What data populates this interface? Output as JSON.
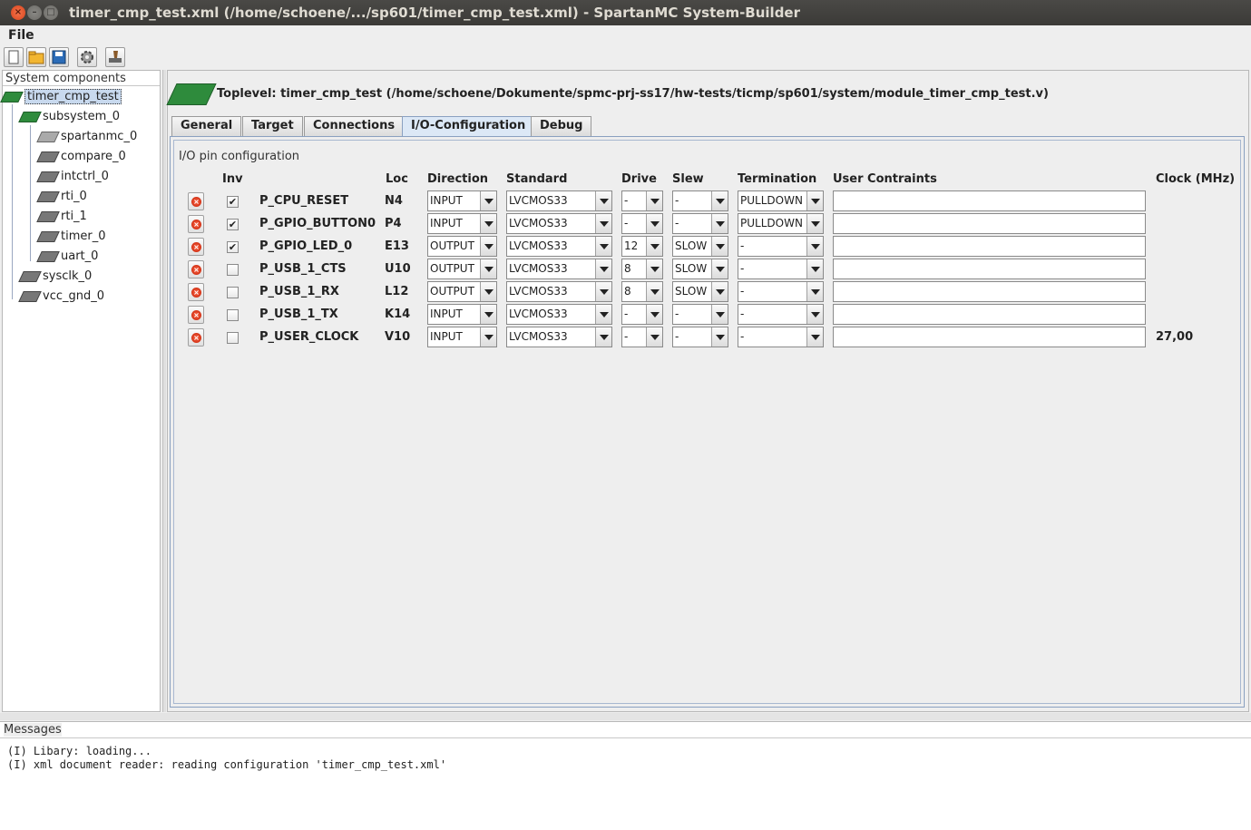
{
  "window": {
    "title": "timer_cmp_test.xml (/home/schoene/.../sp601/timer_cmp_test.xml) - SpartanMC System-Builder"
  },
  "menu": {
    "file": "File"
  },
  "toolbar": {
    "buttons": [
      "new-file-icon",
      "open-folder-icon",
      "save-icon",
      "settings-gear-icon",
      "build-icon"
    ]
  },
  "tree": {
    "header": "System components",
    "items": [
      {
        "label": "timer_cmp_test",
        "icon": "board-icon"
      },
      {
        "label": "subsystem_0",
        "icon": "board-icon"
      },
      {
        "label": "spartanmc_0",
        "icon": "chip-icon"
      },
      {
        "label": "compare_0",
        "icon": "chip-icon"
      },
      {
        "label": "intctrl_0",
        "icon": "chip-icon"
      },
      {
        "label": "rti_0",
        "icon": "chip-icon"
      },
      {
        "label": "rti_1",
        "icon": "chip-icon"
      },
      {
        "label": "timer_0",
        "icon": "chip-icon"
      },
      {
        "label": "uart_0",
        "icon": "chip-icon"
      },
      {
        "label": "sysclk_0",
        "icon": "chip-icon"
      },
      {
        "label": "vcc_gnd_0",
        "icon": "chip-icon"
      }
    ]
  },
  "main": {
    "toplevel": "Toplevel: timer_cmp_test (/home/schoene/Dokumente/spmc-prj-ss17/hw-tests/ticmp/sp601/system/module_timer_cmp_test.v)",
    "tabs": [
      "General",
      "Target",
      "Connections",
      "I/O-Configuration",
      "Debug"
    ],
    "active_tab": "I/O-Configuration",
    "group_title": "I/O pin configuration",
    "columns": {
      "inv": "Inv",
      "loc": "Loc",
      "direction": "Direction",
      "standard": "Standard",
      "drive": "Drive",
      "slew": "Slew",
      "termination": "Termination",
      "user_constraints": "User Contraints",
      "clock": "Clock (MHz)"
    },
    "rows": [
      {
        "inv": "✔",
        "name": "P_CPU_RESET",
        "loc": "N4",
        "direction": "INPUT",
        "standard": "LVCMOS33",
        "drive": "-",
        "slew": "-",
        "termination": "PULLDOWN",
        "user": "",
        "clock": ""
      },
      {
        "inv": "✔",
        "name": "P_GPIO_BUTTON0",
        "loc": "P4",
        "direction": "INPUT",
        "standard": "LVCMOS33",
        "drive": "-",
        "slew": "-",
        "termination": "PULLDOWN",
        "user": "",
        "clock": ""
      },
      {
        "inv": "✔",
        "name": "P_GPIO_LED_0",
        "loc": "E13",
        "direction": "OUTPUT",
        "standard": "LVCMOS33",
        "drive": "12",
        "slew": "SLOW",
        "termination": "-",
        "user": "",
        "clock": ""
      },
      {
        "inv": "",
        "name": "P_USB_1_CTS",
        "loc": "U10",
        "direction": "OUTPUT",
        "standard": "LVCMOS33",
        "drive": "8",
        "slew": "SLOW",
        "termination": "-",
        "user": "",
        "clock": ""
      },
      {
        "inv": "",
        "name": "P_USB_1_RX",
        "loc": "L12",
        "direction": "OUTPUT",
        "standard": "LVCMOS33",
        "drive": "8",
        "slew": "SLOW",
        "termination": "-",
        "user": "",
        "clock": ""
      },
      {
        "inv": "",
        "name": "P_USB_1_TX",
        "loc": "K14",
        "direction": "INPUT",
        "standard": "LVCMOS33",
        "drive": "-",
        "slew": "-",
        "termination": "-",
        "user": "",
        "clock": ""
      },
      {
        "inv": "",
        "name": "P_USER_CLOCK",
        "loc": "V10",
        "direction": "INPUT",
        "standard": "LVCMOS33",
        "drive": "-",
        "slew": "-",
        "termination": "-",
        "user": "",
        "clock": "27,00"
      }
    ]
  },
  "messages": {
    "header": "Messages",
    "lines": [
      "(I) Libary: loading...",
      "(I) xml document reader: reading configuration 'timer_cmp_test.xml'"
    ]
  }
}
